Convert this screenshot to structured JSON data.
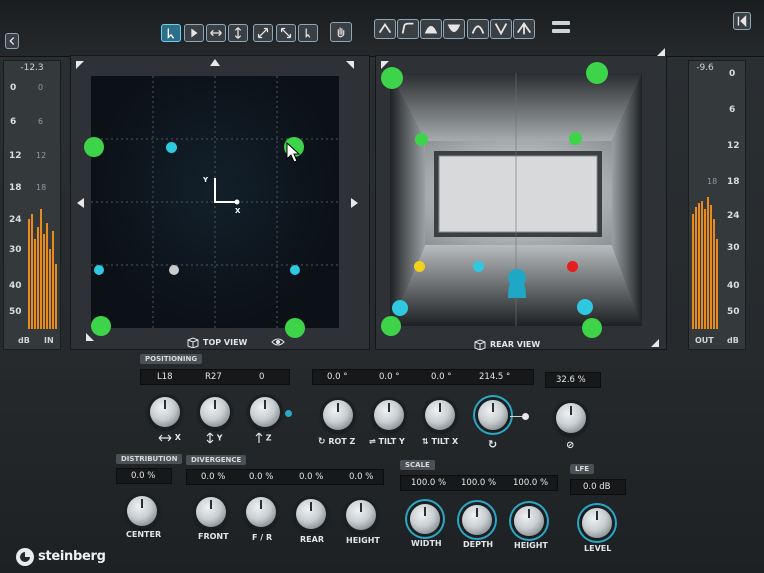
{
  "input_meter": {
    "value": "-12.3",
    "scale": [
      "0",
      "6",
      "12",
      "18",
      "24",
      "30",
      "40",
      "50"
    ],
    "footer_left": "dB",
    "footer_right": "IN"
  },
  "output_meter": {
    "value": "-9.6",
    "scale": [
      "0",
      "6",
      "12",
      "18",
      "24",
      "30",
      "40",
      "50"
    ],
    "footer_left": "OUT",
    "footer_right": "dB"
  },
  "top_view": {
    "label": "TOP VIEW",
    "axis_x": "X",
    "axis_y": "Y"
  },
  "rear_view": {
    "label": "REAR VIEW"
  },
  "positioning": {
    "label": "POSITIONING",
    "fields_a": [
      "L18",
      "R27",
      "0"
    ],
    "fields_b": [
      "0.0 °",
      "0.0 °",
      "0.0 °",
      "214.5 °"
    ],
    "field_c": "32.6 %",
    "knobs": [
      "X",
      "Y",
      "Z",
      "ROT Z",
      "TILT Y",
      "TILT X"
    ]
  },
  "distribution": {
    "label": "DISTRIBUTION",
    "value": "0.0 %",
    "knob": "CENTER"
  },
  "divergence": {
    "label": "DIVERGENCE",
    "values": [
      "0.0 %",
      "0.0 %",
      "0.0 %",
      "0.0 %"
    ],
    "knobs": [
      "FRONT",
      "F / R",
      "REAR",
      "HEIGHT"
    ]
  },
  "scale": {
    "label": "SCALE",
    "values": [
      "100.0 %",
      "100.0 %",
      "100.0 %"
    ],
    "knobs": [
      "WIDTH",
      "DEPTH",
      "HEIGHT"
    ]
  },
  "lfe": {
    "label": "LFE",
    "value": "0.0 dB",
    "knob": "LEVEL"
  },
  "brand": "steinberg",
  "colors": {
    "accent": "#2aa7c4",
    "speaker_green": "#3ed44a",
    "source_cyan": "#2ec9e0",
    "meter_orange": "#e98a1c"
  }
}
